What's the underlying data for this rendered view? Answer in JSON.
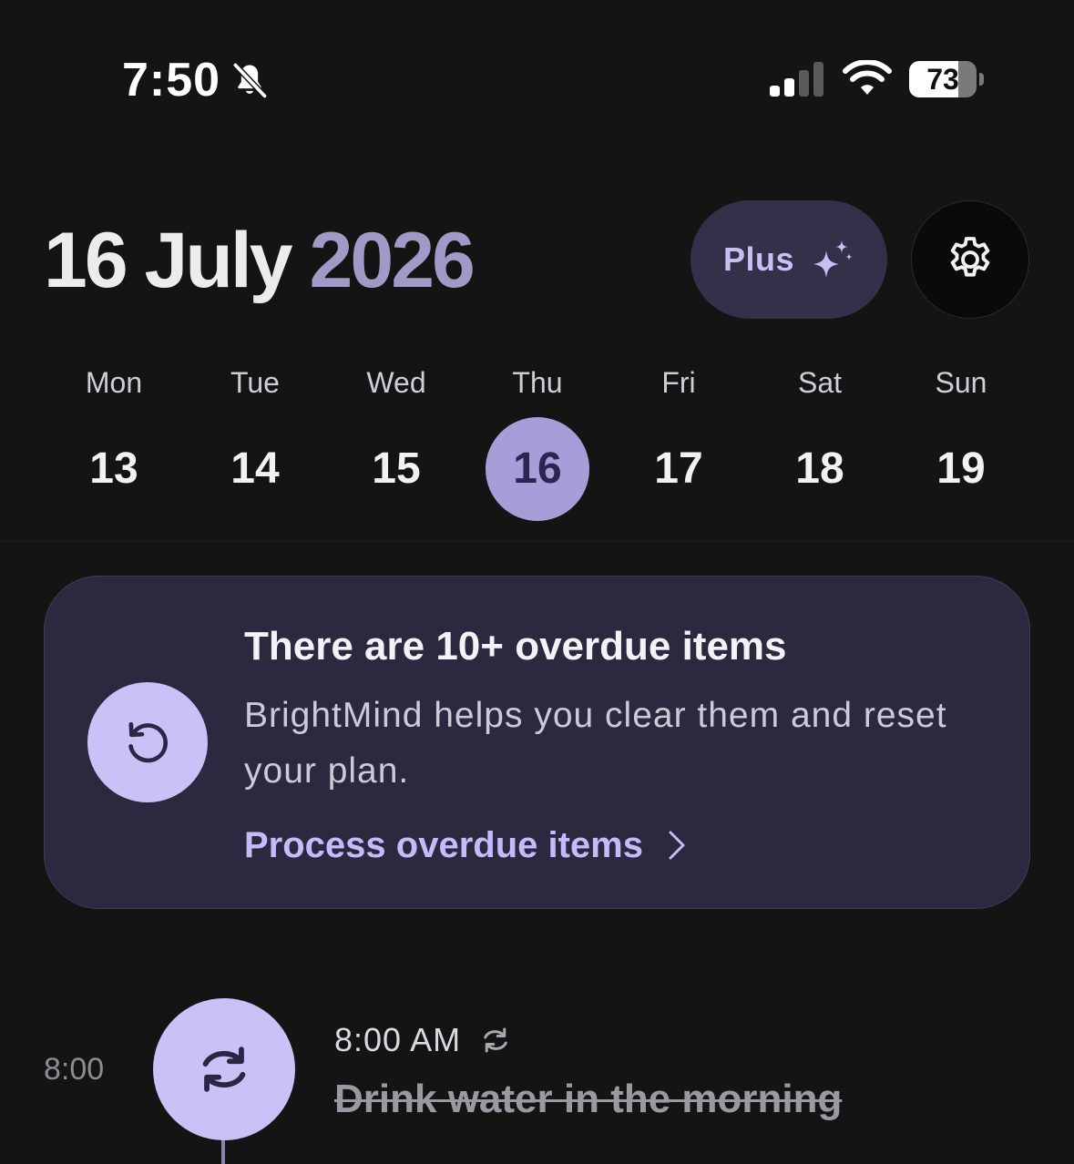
{
  "status_bar": {
    "time": "7:50",
    "battery_level": "73",
    "battery_fraction": 0.73,
    "icons": [
      "bell-slash-icon",
      "cellular-signal-icon",
      "wifi-icon",
      "battery-icon"
    ]
  },
  "header": {
    "date_day_month": "16 July",
    "date_year": "2026",
    "plus_label": "Plus",
    "plus_icon": "sparkle-icon",
    "settings_icon": "gear-icon"
  },
  "week": {
    "days": [
      {
        "name": "Mon",
        "num": "13",
        "selected": false
      },
      {
        "name": "Tue",
        "num": "14",
        "selected": false
      },
      {
        "name": "Wed",
        "num": "15",
        "selected": false
      },
      {
        "name": "Thu",
        "num": "16",
        "selected": true
      },
      {
        "name": "Fri",
        "num": "17",
        "selected": false
      },
      {
        "name": "Sat",
        "num": "18",
        "selected": false
      },
      {
        "name": "Sun",
        "num": "19",
        "selected": false
      }
    ]
  },
  "overdue_card": {
    "title": "There are 10+ overdue items",
    "description": "BrightMind helps you clear them and reset your plan.",
    "link_label": "Process overdue items",
    "icon": "reset-icon"
  },
  "tasks": [
    {
      "time_label": "8:00",
      "time": "8:00 AM",
      "title": "Drink water in the morning",
      "completed": true,
      "icon": "repeat-icon"
    }
  ],
  "colors": {
    "background": "#141414",
    "accent": "#a79dd8",
    "accent_light": "#cbc1f6",
    "card_background": "#2b283f",
    "link": "#c6bbf8",
    "year": "#a29ac6"
  }
}
